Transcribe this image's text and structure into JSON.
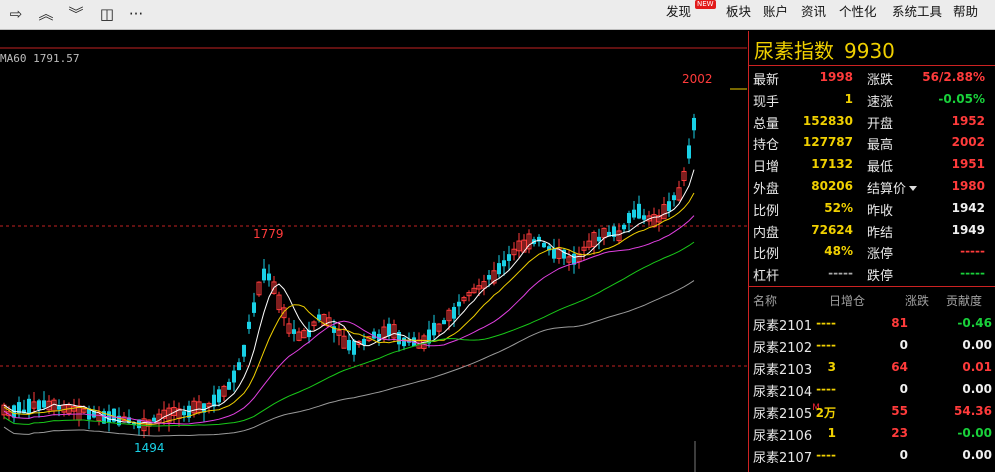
{
  "toolbar": {
    "icons": [
      "back-arrow-icon",
      "collapse-up-icon",
      "expand-down-icon",
      "layout-grid-icon",
      "more-icon"
    ],
    "menu": [
      "发现",
      "板块",
      "账户",
      "资讯",
      "个性化",
      "系统工具",
      "帮助"
    ],
    "new_badge": "NEW"
  },
  "chart": {
    "ma_label": "MA60 1791.57",
    "high_label": "2002",
    "mid_label": "1779",
    "low_label": "1494",
    "colors": {
      "up": "#ff3b3b",
      "down": "#19d1e6",
      "ma5": "#ffffff",
      "ma10": "#f0d000",
      "ma20": "#e040e0",
      "ma40": "#19c819",
      "ma60": "#9a9a9a",
      "ref": "#c22222"
    }
  },
  "panel": {
    "title": "尿素指数",
    "code": "9930",
    "quote": [
      {
        "lk": "最新",
        "lv": "1998",
        "lc": "red",
        "rk": "涨跌",
        "rv": "56/2.88%",
        "rc": "red"
      },
      {
        "lk": "现手",
        "lv": "1",
        "lc": "yellow",
        "rk": "速涨",
        "rv": "-0.05%",
        "rc": "green"
      },
      {
        "lk": "总量",
        "lv": "152830",
        "lc": "yellow",
        "rk": "开盘",
        "rv": "1952",
        "rc": "red"
      },
      {
        "lk": "持仓",
        "lv": "127787",
        "lc": "yellow",
        "rk": "最高",
        "rv": "2002",
        "rc": "red"
      },
      {
        "lk": "日增",
        "lv": "17132",
        "lc": "yellow",
        "rk": "最低",
        "rv": "1951",
        "rc": "red"
      },
      {
        "lk": "外盘",
        "lv": "80206",
        "lc": "yellow",
        "rk": "结算价",
        "rv": "1980",
        "rc": "red",
        "dropdown": true
      },
      {
        "lk": "比例",
        "lv": "52%",
        "lc": "yellow",
        "rk": "昨收",
        "rv": "1942",
        "rc": "white"
      },
      {
        "lk": "内盘",
        "lv": "72624",
        "lc": "yellow",
        "rk": "昨结",
        "rv": "1949",
        "rc": "white"
      },
      {
        "lk": "比例",
        "lv": "48%",
        "lc": "yellow",
        "rk": "涨停",
        "rv": "-----",
        "rc": "red"
      },
      {
        "lk": "杠杆",
        "lv": "-----",
        "lc": "grey",
        "rk": "跌停",
        "rv": "-----",
        "rc": "green"
      }
    ],
    "list_headers": {
      "name": "名称",
      "inc": "日增仓",
      "chg": "涨跌",
      "con": "贡献度"
    },
    "contracts": [
      {
        "name": "尿素2101",
        "mark": "",
        "inc": "----",
        "ic": "yellow",
        "chg": "81",
        "cc": "red",
        "con": "-0.46",
        "oc": "green"
      },
      {
        "name": "尿素2102",
        "mark": "",
        "inc": "----",
        "ic": "yellow",
        "chg": "0",
        "cc": "white",
        "con": "0.00",
        "oc": "white"
      },
      {
        "name": "尿素2103",
        "mark": "",
        "inc": "3",
        "ic": "yellow",
        "chg": "64",
        "cc": "red",
        "con": "0.01",
        "oc": "red"
      },
      {
        "name": "尿素2104",
        "mark": "",
        "inc": "----",
        "ic": "yellow",
        "chg": "0",
        "cc": "white",
        "con": "0.00",
        "oc": "white"
      },
      {
        "name": "尿素2105",
        "mark": "M",
        "inc": "2万",
        "ic": "yellow",
        "chg": "55",
        "cc": "red",
        "con": "54.36",
        "oc": "red"
      },
      {
        "name": "尿素2106",
        "mark": "",
        "inc": "1",
        "ic": "yellow",
        "chg": "23",
        "cc": "red",
        "con": "-0.00",
        "oc": "green"
      },
      {
        "name": "尿素2107",
        "mark": "",
        "inc": "----",
        "ic": "yellow",
        "chg": "0",
        "cc": "white",
        "con": "0.00",
        "oc": "white"
      }
    ]
  }
}
